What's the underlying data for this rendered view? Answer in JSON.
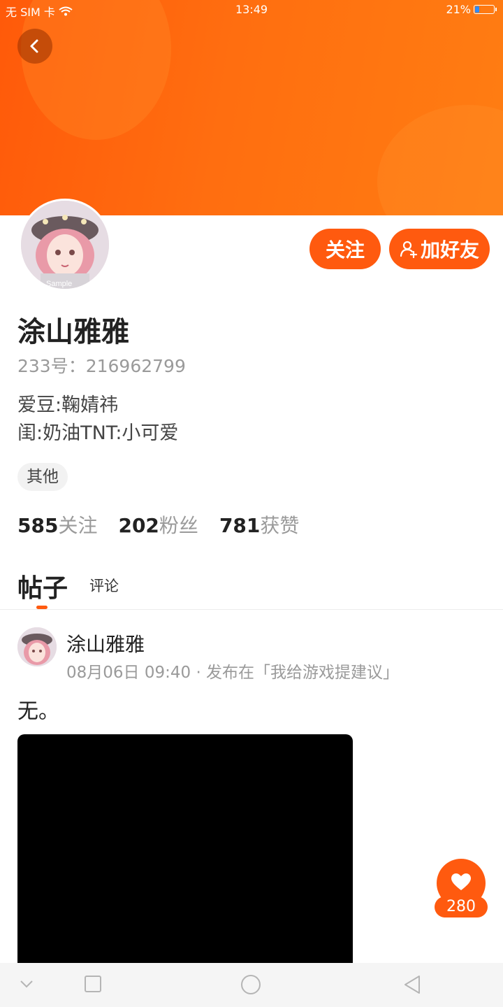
{
  "status_bar": {
    "carrier": "无 SIM 卡",
    "time": "13:49",
    "battery": "21%"
  },
  "profile": {
    "name": "涂山雅雅",
    "id_label": "233号：",
    "id_value": "216962799",
    "bio_lines": [
      "爱豆:鞠婧祎",
      "闺:奶油TNT:小可爱"
    ],
    "tag": "其他",
    "follow_label": "关注",
    "add_friend_label": "加好友",
    "avatar_watermark": "Sample"
  },
  "stats": [
    {
      "num": "585",
      "label": "关注"
    },
    {
      "num": "202",
      "label": "粉丝"
    },
    {
      "num": "781",
      "label": "获赞"
    }
  ],
  "tabs": {
    "posts": "帖子",
    "comments": "评论"
  },
  "post": {
    "author": "涂山雅雅",
    "meta": "08月06日 09:40 · 发布在「我给游戏提建议」",
    "text": "无。",
    "likes": "280"
  },
  "colors": {
    "accent": "#ff5a0f",
    "banner": "#ff6e10"
  },
  "icons": {
    "back": "chevron-left-icon",
    "add_friend": "person-plus-icon",
    "like": "heart-icon",
    "nav": [
      "chevron-down-icon",
      "square-icon",
      "circle-icon",
      "triangle-back-icon"
    ]
  }
}
